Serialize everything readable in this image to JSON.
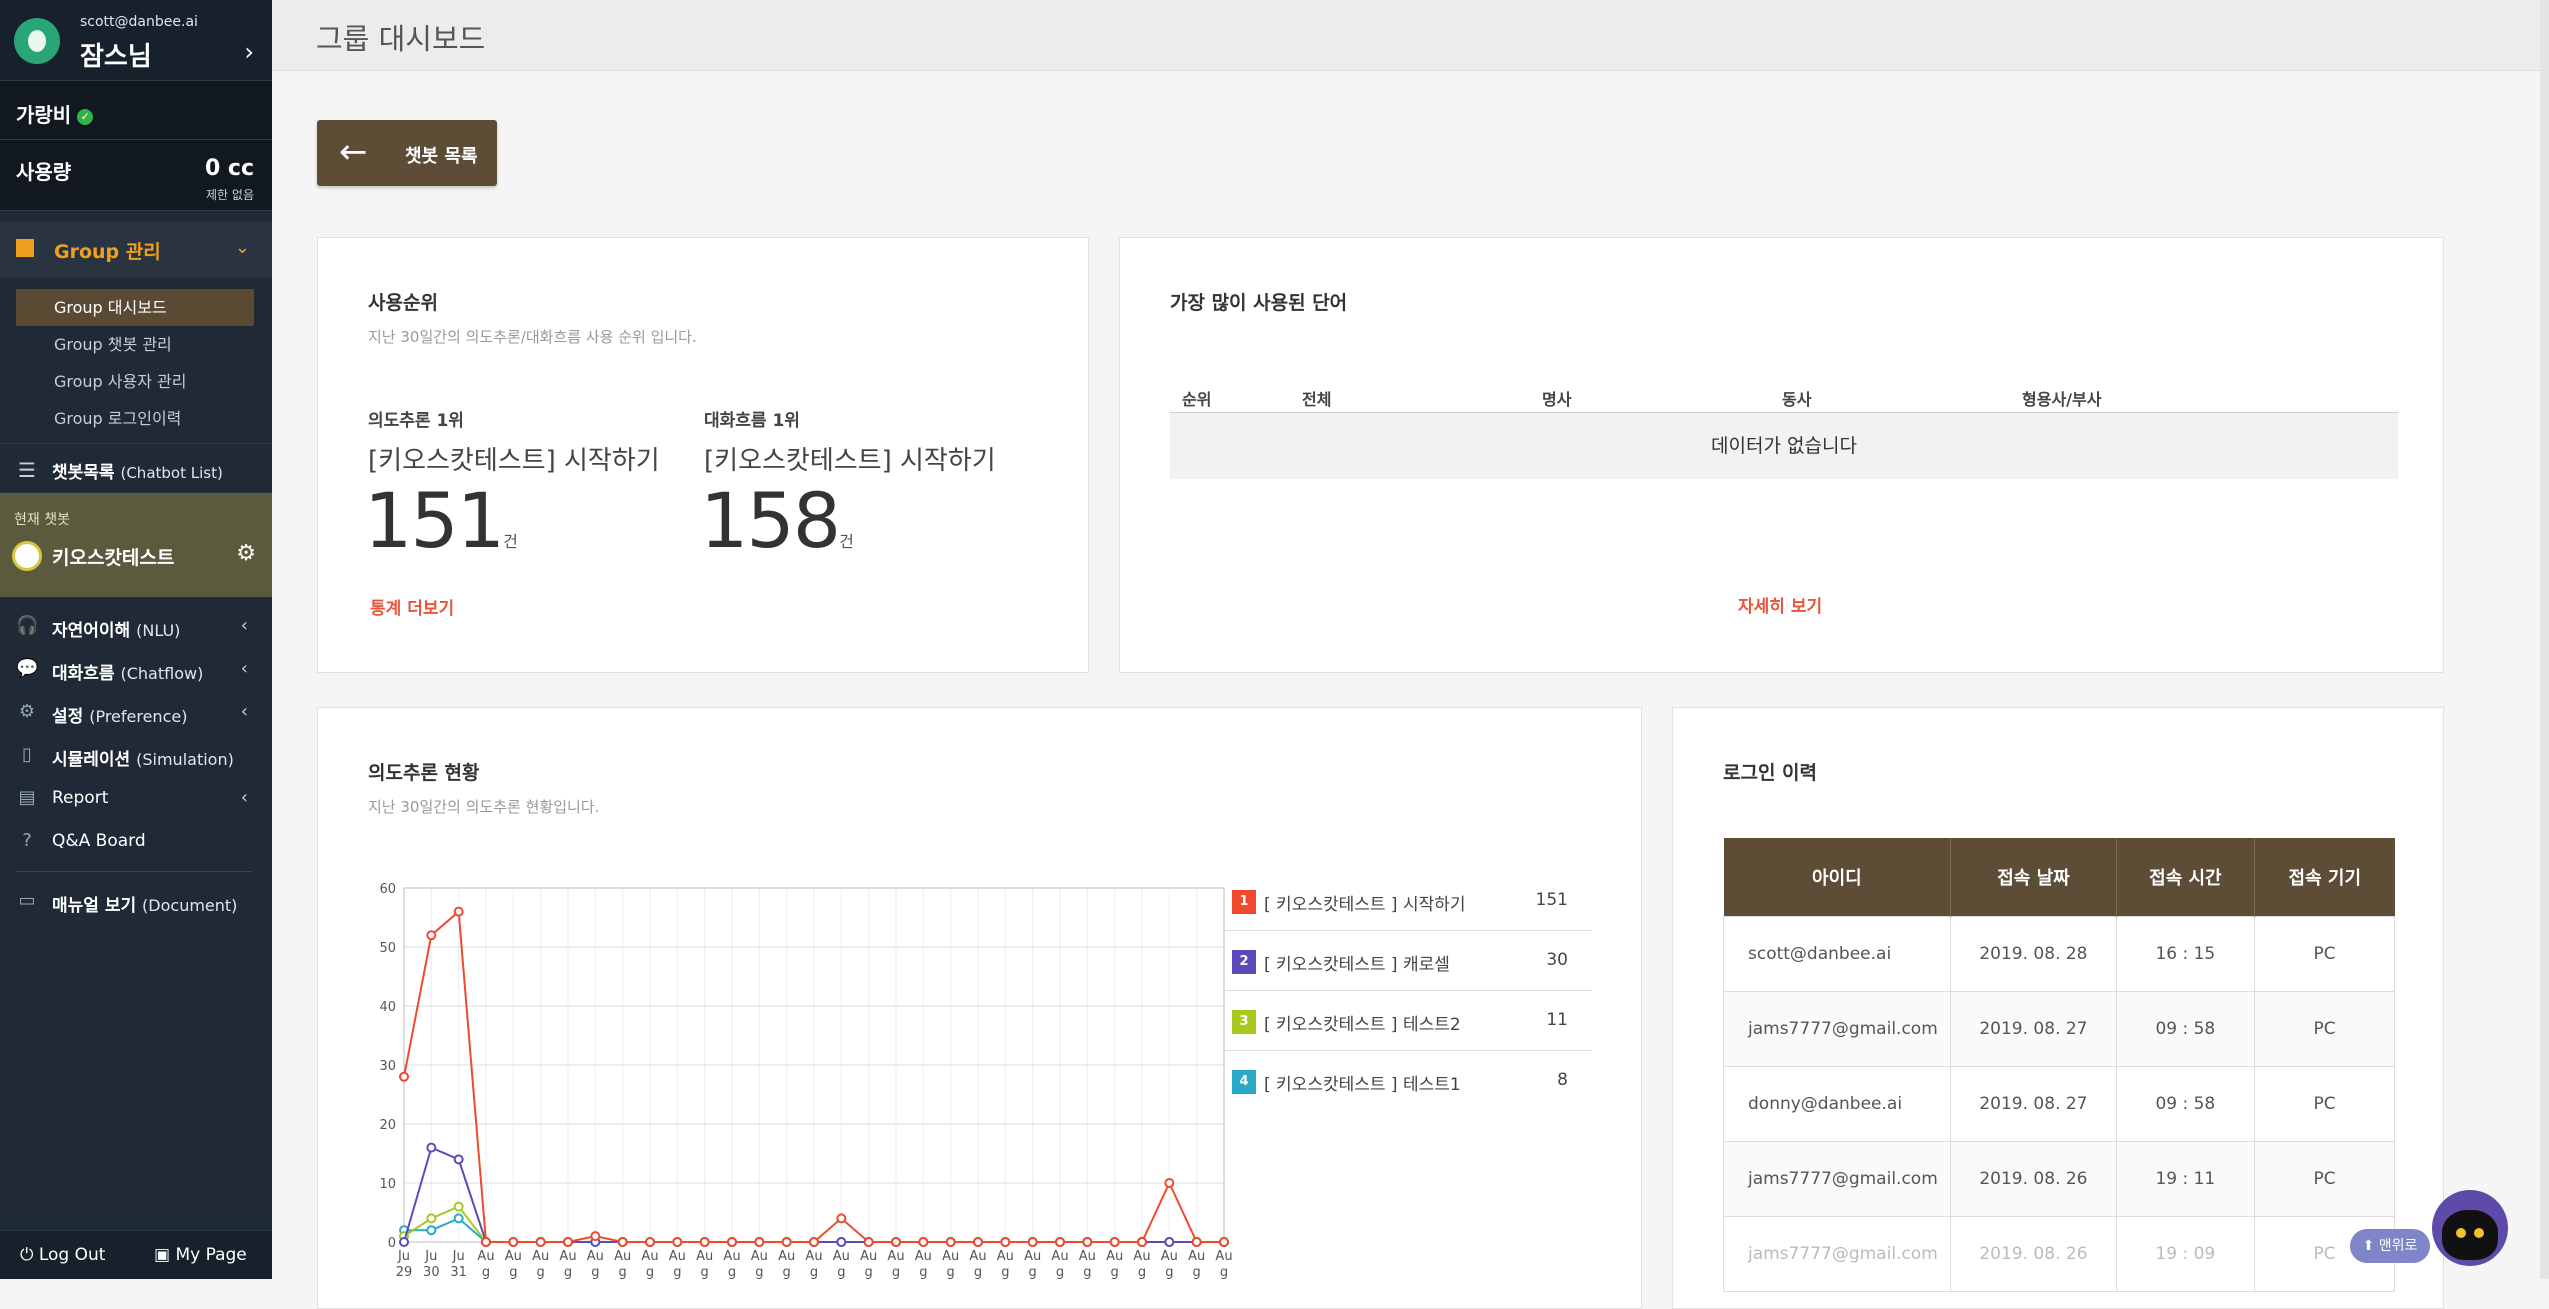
{
  "sidebar": {
    "email": "scott@danbee.ai",
    "user_name": "잠스님",
    "plan_name": "가랑비",
    "usage_label": "사용량",
    "usage_value": "0 cc",
    "usage_sub": "제한 없음",
    "group_label": "Group 관리",
    "group_items": [
      "Group 대시보드",
      "Group 챗봇 관리",
      "Group 사용자 관리",
      "Group 로그인이력"
    ],
    "chatbot_list_label": "챗봇목록",
    "chatbot_list_sub": "(Chatbot List)",
    "current_bot_title": "현재 챗봇",
    "current_bot_name": "키오스캇테스트",
    "nav": [
      {
        "label": "자연어이해",
        "sub": "(NLU)"
      },
      {
        "label": "대화흐름",
        "sub": "(Chatflow)"
      },
      {
        "label": "설정",
        "sub": "(Preference)"
      },
      {
        "label": "시뮬레이션",
        "sub": "(Simulation)"
      },
      {
        "label": "Report",
        "sub": ""
      },
      {
        "label": "Q&A Board",
        "sub": ""
      },
      {
        "label": "매뉴얼 보기",
        "sub": "(Document)"
      }
    ],
    "logout_label": "Log Out",
    "mypage_label": "My Page"
  },
  "header": {
    "title": "그룹 대시보드"
  },
  "back_button": {
    "label": "챗봇 목록"
  },
  "ranking": {
    "title": "사용순위",
    "subtitle": "지난 30일간의 의도추론/대화흐름 사용 순위 입니다.",
    "intent_label": "의도추론 1위",
    "intent_name": "[키오스캇테스트] 시작하기",
    "intent_count": "151",
    "flow_label": "대화흐름 1위",
    "flow_name": "[키오스캇테스트] 시작하기",
    "flow_count": "158",
    "unit": "건",
    "more_link": "통계 더보기"
  },
  "words": {
    "title": "가장 많이 사용된 단어",
    "columns": [
      "순위",
      "전체",
      "명사",
      "동사",
      "형용사/부사"
    ],
    "empty": "데이터가 없습니다",
    "more_link": "자세히 보기"
  },
  "intent_status": {
    "title": "의도추론 현황",
    "subtitle": "지난 30일간의 의도추론 현황입니다.",
    "legend": [
      {
        "no": "1",
        "name": "[ 키오스캇테스트 ] 시작하기",
        "value": "151",
        "color": "#f04a2e"
      },
      {
        "no": "2",
        "name": "[ 키오스캇테스트 ] 캐로셀",
        "value": "30",
        "color": "#5b4bb8"
      },
      {
        "no": "3",
        "name": "[ 키오스캇테스트 ] 테스트2",
        "value": "11",
        "color": "#a7c91f"
      },
      {
        "no": "4",
        "name": "[ 키오스캇테스트 ] 테스트1",
        "value": "8",
        "color": "#2aa8c8"
      }
    ]
  },
  "chart_data": {
    "type": "line",
    "x": [
      "Jul 29",
      "Jul 30",
      "Jul 31",
      "Aug",
      "Aug",
      "Aug",
      "Aug",
      "Aug",
      "Aug",
      "Aug",
      "Aug",
      "Aug",
      "Aug",
      "Aug",
      "Aug",
      "Aug",
      "Aug",
      "Aug",
      "Aug",
      "Aug",
      "Aug",
      "Aug",
      "Aug",
      "Aug",
      "Aug",
      "Aug",
      "Aug",
      "Aug",
      "Aug",
      "Aug",
      "Aug"
    ],
    "ylim": [
      0,
      60
    ],
    "yticks": [
      0,
      10,
      20,
      30,
      40,
      50,
      60
    ],
    "series": [
      {
        "color": "#f04a2e",
        "values": [
          28,
          52,
          56,
          0,
          0,
          0,
          0,
          1,
          0,
          0,
          0,
          0,
          0,
          0,
          0,
          0,
          4,
          0,
          0,
          0,
          0,
          0,
          0,
          0,
          0,
          0,
          0,
          0,
          10,
          0,
          0
        ]
      },
      {
        "color": "#5b4bb8",
        "values": [
          0,
          16,
          14,
          0,
          0,
          0,
          0,
          0,
          0,
          0,
          0,
          0,
          0,
          0,
          0,
          0,
          0,
          0,
          0,
          0,
          0,
          0,
          0,
          0,
          0,
          0,
          0,
          0,
          0,
          0,
          0
        ]
      },
      {
        "color": "#a7c91f",
        "values": [
          1,
          4,
          6,
          0,
          0,
          0,
          0,
          0,
          0,
          0,
          0,
          0,
          0,
          0,
          0,
          0,
          0,
          0,
          0,
          0,
          0,
          0,
          0,
          0,
          0,
          0,
          0,
          0,
          0,
          0,
          0
        ]
      },
      {
        "color": "#2aa8c8",
        "values": [
          2,
          2,
          4,
          0,
          0,
          0,
          0,
          0,
          0,
          0,
          0,
          0,
          0,
          0,
          0,
          0,
          0,
          0,
          0,
          0,
          0,
          0,
          0,
          0,
          0,
          0,
          0,
          0,
          0,
          0,
          0
        ]
      }
    ]
  },
  "login_history": {
    "title": "로그인 이력",
    "columns": [
      "아이디",
      "접속 날짜",
      "접속 시간",
      "접속 기기"
    ],
    "rows": [
      [
        "scott@danbee.ai",
        "2019. 08. 28",
        "16 : 15",
        "PC"
      ],
      [
        "jams7777@gmail.com",
        "2019. 08. 27",
        "09 : 58",
        "PC"
      ],
      [
        "donny@danbee.ai",
        "2019. 08. 27",
        "09 : 58",
        "PC"
      ],
      [
        "jams7777@gmail.com",
        "2019. 08. 26",
        "19 : 11",
        "PC"
      ],
      [
        "jams7777@gmail.com",
        "2019. 08. 26",
        "19 : 09",
        "PC"
      ]
    ]
  },
  "up_button": {
    "label": "⬆ 맨위로"
  }
}
